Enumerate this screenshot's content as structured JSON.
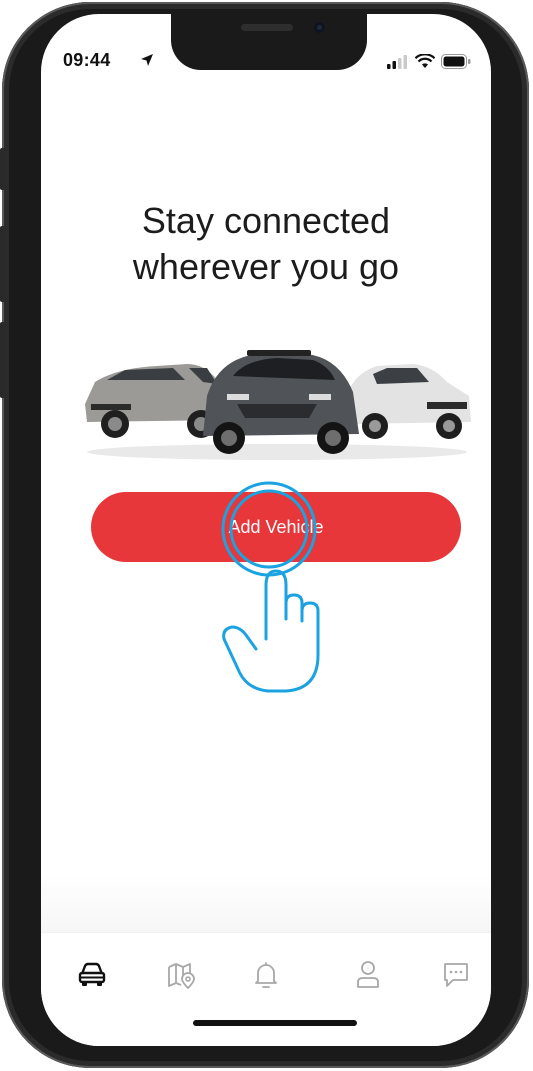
{
  "status_bar": {
    "time": "09:44"
  },
  "headline": {
    "line1": "Stay connected",
    "line2": "wherever you go"
  },
  "primary_action": {
    "label": "Add Vehicle",
    "color": "#e8373a"
  },
  "tab_bar": {
    "items": [
      {
        "icon": "car-icon",
        "active": true
      },
      {
        "icon": "map-pin-icon",
        "active": false
      },
      {
        "icon": "bell-icon",
        "active": false
      },
      {
        "icon": "user-icon",
        "active": false
      },
      {
        "icon": "chat-icon",
        "active": false
      }
    ]
  },
  "overlay": {
    "icon": "tap-gesture-hand-icon",
    "color": "#1aa3e0"
  }
}
